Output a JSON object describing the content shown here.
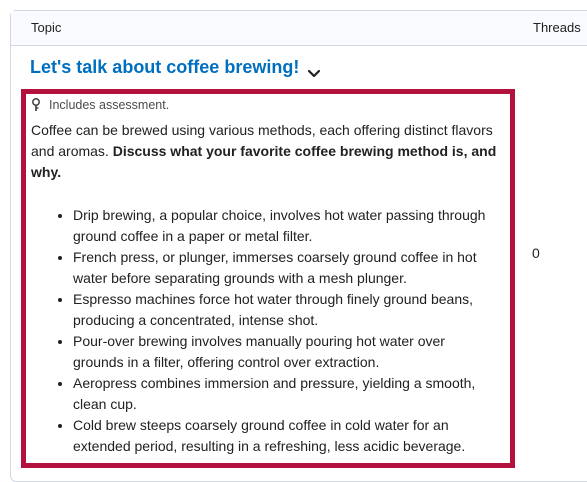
{
  "table": {
    "headers": {
      "topic": "Topic",
      "threads": "Threads"
    }
  },
  "topic": {
    "title": "Let's talk about coffee brewing!",
    "assessment_note": "Includes assessment.",
    "intro": "Coffee can be brewed using various methods, each offering distinct flavors and aromas. ",
    "prompt": "Discuss what your favorite coffee brewing method is, and why.",
    "bullets": [
      "Drip brewing, a popular choice, involves hot water passing through ground coffee in a paper or metal filter.",
      "French press, or plunger, immerses coarsely ground coffee in hot water before separating grounds with a mesh plunger.",
      "Espresso machines force hot water through finely ground beans, producing a concentrated, intense shot.",
      "Pour-over brewing involves manually pouring hot water over grounds in a filter, offering control over extraction.",
      "Aeropress combines immersion and pressure, yielding a smooth, clean cup.",
      "Cold brew steeps coarsely ground coffee in cold water for an extended period, resulting in a refreshing, less acidic beverage."
    ],
    "threads": "0"
  },
  "icons": {
    "assessment": "rubric-pin-icon",
    "expand": "chevron-down-icon"
  },
  "colors": {
    "link": "#006fbf",
    "highlight": "#b3123e",
    "header_bg": "#f9fbff"
  }
}
